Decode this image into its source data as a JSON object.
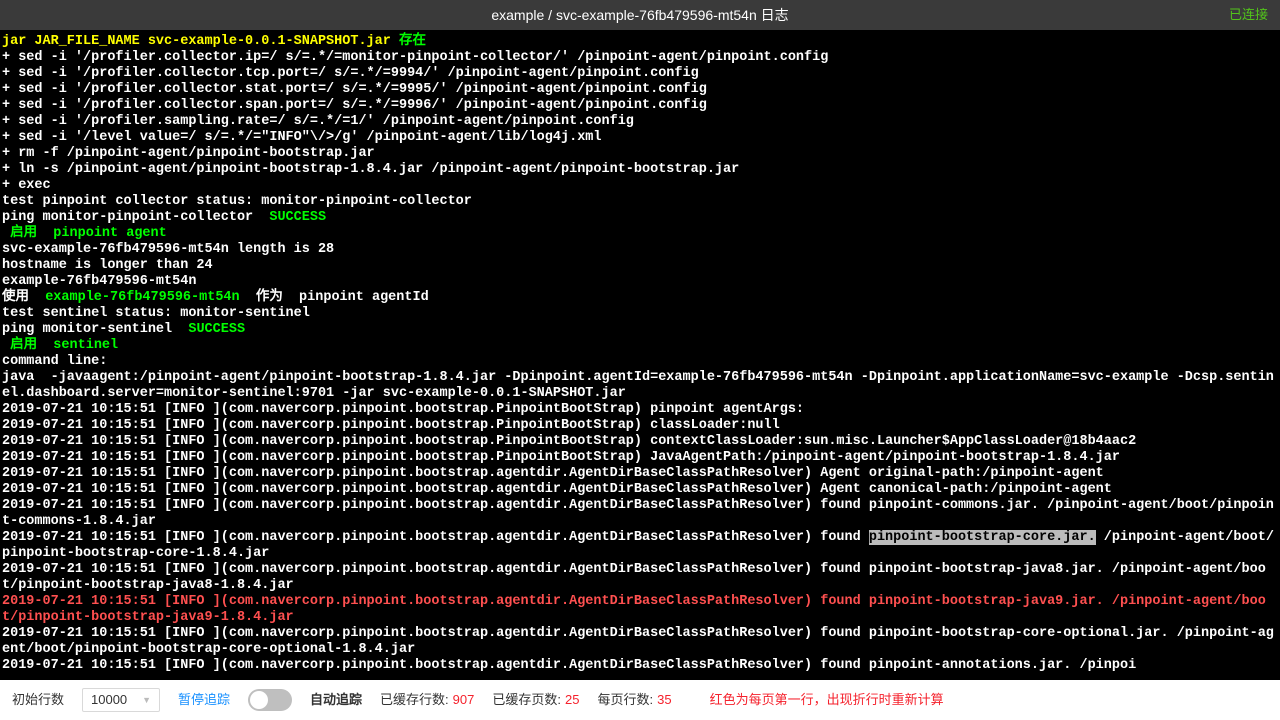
{
  "header": {
    "title": "example / svc-example-76fb479596-mt54n 日志",
    "status": "已连接"
  },
  "log": {
    "l1_a": "jar JAR_FILE_NAME svc-example-0.0.1-SNAPSHOT.jar",
    "l1_b": " 存在",
    "l2": "+ sed -i '/profiler.collector.ip=/ s/=.*/=monitor-pinpoint-collector/' /pinpoint-agent/pinpoint.config",
    "l3": "+ sed -i '/profiler.collector.tcp.port=/ s/=.*/=9994/' /pinpoint-agent/pinpoint.config",
    "l4": "+ sed -i '/profiler.collector.stat.port=/ s/=.*/=9995/' /pinpoint-agent/pinpoint.config",
    "l5": "+ sed -i '/profiler.collector.span.port=/ s/=.*/=9996/' /pinpoint-agent/pinpoint.config",
    "l6": "+ sed -i '/profiler.sampling.rate=/ s/=.*/=1/' /pinpoint-agent/pinpoint.config",
    "l7": "+ sed -i '/level value=/ s/=.*/=\"INFO\"\\/>/g' /pinpoint-agent/lib/log4j.xml",
    "l8": "+ rm -f /pinpoint-agent/pinpoint-bootstrap.jar",
    "l9": "+ ln -s /pinpoint-agent/pinpoint-bootstrap-1.8.4.jar /pinpoint-agent/pinpoint-bootstrap.jar",
    "l10": "+ exec",
    "l11": "test pinpoint collector status: monitor-pinpoint-collector",
    "l12_a": "ping monitor-pinpoint-collector  ",
    "l12_b": "SUCCESS",
    "l13": " 启用  pinpoint agent",
    "l14": "svc-example-76fb479596-mt54n length is 28",
    "l15": "hostname is longer than 24",
    "l16": "example-76fb479596-mt54n",
    "l17_a": "使用  ",
    "l17_b": "example-76fb479596-mt54n ",
    "l17_c": " 作为  pinpoint agentId",
    "l18": "test sentinel status: monitor-sentinel",
    "l19_a": "ping monitor-sentinel  ",
    "l19_b": "SUCCESS",
    "l20": " 启用  sentinel",
    "l21": "command line:",
    "l22": "java  -javaagent:/pinpoint-agent/pinpoint-bootstrap-1.8.4.jar -Dpinpoint.agentId=example-76fb479596-mt54n -Dpinpoint.applicationName=svc-example -Dcsp.sentinel.dashboard.server=monitor-sentinel:9701 -jar svc-example-0.0.1-SNAPSHOT.jar",
    "l23": "2019-07-21 10:15:51 [INFO ](com.navercorp.pinpoint.bootstrap.PinpointBootStrap) pinpoint agentArgs:",
    "l24": "2019-07-21 10:15:51 [INFO ](com.navercorp.pinpoint.bootstrap.PinpointBootStrap) classLoader:null",
    "l25": "2019-07-21 10:15:51 [INFO ](com.navercorp.pinpoint.bootstrap.PinpointBootStrap) contextClassLoader:sun.misc.Launcher$AppClassLoader@18b4aac2",
    "l26": "2019-07-21 10:15:51 [INFO ](com.navercorp.pinpoint.bootstrap.PinpointBootStrap) JavaAgentPath:/pinpoint-agent/pinpoint-bootstrap-1.8.4.jar",
    "l27": "2019-07-21 10:15:51 [INFO ](com.navercorp.pinpoint.bootstrap.agentdir.AgentDirBaseClassPathResolver) Agent original-path:/pinpoint-agent",
    "l28": "2019-07-21 10:15:51 [INFO ](com.navercorp.pinpoint.bootstrap.agentdir.AgentDirBaseClassPathResolver) Agent canonical-path:/pinpoint-agent",
    "l29": "2019-07-21 10:15:51 [INFO ](com.navercorp.pinpoint.bootstrap.agentdir.AgentDirBaseClassPathResolver) found pinpoint-commons.jar. /pinpoint-agent/boot/pinpoint-commons-1.8.4.jar",
    "l30_a": "2019-07-21 10:15:51 [INFO ](com.navercorp.pinpoint.bootstrap.agentdir.AgentDirBaseClassPathResolver) found ",
    "l30_b": "pinpoint-bootstrap-core.jar.",
    "l30_c": " /pinpoint-agent/boot/pinpoint-bootstrap-core-1.8.4.jar",
    "l31": "2019-07-21 10:15:51 [INFO ](com.navercorp.pinpoint.bootstrap.agentdir.AgentDirBaseClassPathResolver) found pinpoint-bootstrap-java8.jar. /pinpoint-agent/boot/pinpoint-bootstrap-java8-1.8.4.jar",
    "l32": "2019-07-21 10:15:51 [INFO ](com.navercorp.pinpoint.bootstrap.agentdir.AgentDirBaseClassPathResolver) found pinpoint-bootstrap-java9.jar. /pinpoint-agent/boot/pinpoint-bootstrap-java9-1.8.4.jar",
    "l33": "2019-07-21 10:15:51 [INFO ](com.navercorp.pinpoint.bootstrap.agentdir.AgentDirBaseClassPathResolver) found pinpoint-bootstrap-core-optional.jar. /pinpoint-agent/boot/pinpoint-bootstrap-core-optional-1.8.4.jar",
    "l34": "2019-07-21 10:15:51 [INFO ](com.navercorp.pinpoint.bootstrap.agentdir.AgentDirBaseClassPathResolver) found pinpoint-annotations.jar. /pinpoi"
  },
  "footer": {
    "initial_lines_label": "初始行数",
    "initial_lines_value": "10000",
    "pause_tracking": "暂停追踪",
    "auto_tracking": "自动追踪",
    "cached_lines_label": "已缓存行数:",
    "cached_lines_value": "907",
    "cached_pages_label": "已缓存页数:",
    "cached_pages_value": "25",
    "lines_per_page_label": "每页行数:",
    "lines_per_page_value": "35",
    "note": "红色为每页第一行，出现折行时重新计算"
  }
}
